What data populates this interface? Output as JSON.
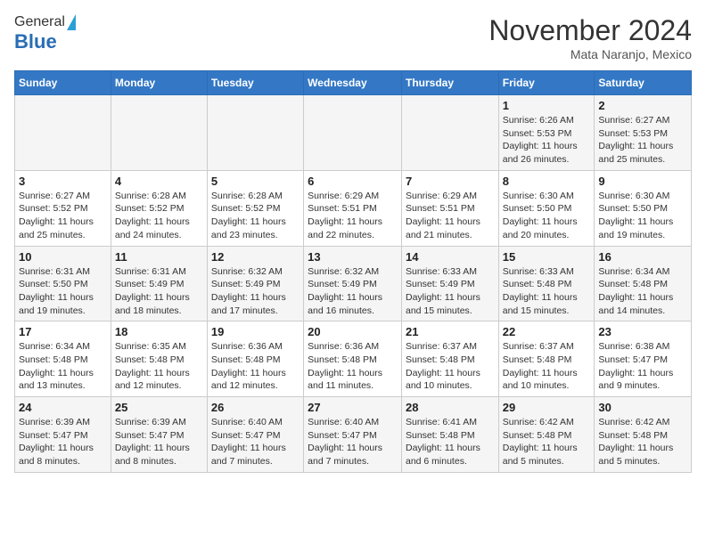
{
  "header": {
    "logo_general": "General",
    "logo_blue": "Blue",
    "month_title": "November 2024",
    "location": "Mata Naranjo, Mexico"
  },
  "columns": [
    "Sunday",
    "Monday",
    "Tuesday",
    "Wednesday",
    "Thursday",
    "Friday",
    "Saturday"
  ],
  "weeks": [
    [
      {
        "day": "",
        "info": ""
      },
      {
        "day": "",
        "info": ""
      },
      {
        "day": "",
        "info": ""
      },
      {
        "day": "",
        "info": ""
      },
      {
        "day": "",
        "info": ""
      },
      {
        "day": "1",
        "info": "Sunrise: 6:26 AM\nSunset: 5:53 PM\nDaylight: 11 hours and 26 minutes."
      },
      {
        "day": "2",
        "info": "Sunrise: 6:27 AM\nSunset: 5:53 PM\nDaylight: 11 hours and 25 minutes."
      }
    ],
    [
      {
        "day": "3",
        "info": "Sunrise: 6:27 AM\nSunset: 5:52 PM\nDaylight: 11 hours and 25 minutes."
      },
      {
        "day": "4",
        "info": "Sunrise: 6:28 AM\nSunset: 5:52 PM\nDaylight: 11 hours and 24 minutes."
      },
      {
        "day": "5",
        "info": "Sunrise: 6:28 AM\nSunset: 5:52 PM\nDaylight: 11 hours and 23 minutes."
      },
      {
        "day": "6",
        "info": "Sunrise: 6:29 AM\nSunset: 5:51 PM\nDaylight: 11 hours and 22 minutes."
      },
      {
        "day": "7",
        "info": "Sunrise: 6:29 AM\nSunset: 5:51 PM\nDaylight: 11 hours and 21 minutes."
      },
      {
        "day": "8",
        "info": "Sunrise: 6:30 AM\nSunset: 5:50 PM\nDaylight: 11 hours and 20 minutes."
      },
      {
        "day": "9",
        "info": "Sunrise: 6:30 AM\nSunset: 5:50 PM\nDaylight: 11 hours and 19 minutes."
      }
    ],
    [
      {
        "day": "10",
        "info": "Sunrise: 6:31 AM\nSunset: 5:50 PM\nDaylight: 11 hours and 19 minutes."
      },
      {
        "day": "11",
        "info": "Sunrise: 6:31 AM\nSunset: 5:49 PM\nDaylight: 11 hours and 18 minutes."
      },
      {
        "day": "12",
        "info": "Sunrise: 6:32 AM\nSunset: 5:49 PM\nDaylight: 11 hours and 17 minutes."
      },
      {
        "day": "13",
        "info": "Sunrise: 6:32 AM\nSunset: 5:49 PM\nDaylight: 11 hours and 16 minutes."
      },
      {
        "day": "14",
        "info": "Sunrise: 6:33 AM\nSunset: 5:49 PM\nDaylight: 11 hours and 15 minutes."
      },
      {
        "day": "15",
        "info": "Sunrise: 6:33 AM\nSunset: 5:48 PM\nDaylight: 11 hours and 15 minutes."
      },
      {
        "day": "16",
        "info": "Sunrise: 6:34 AM\nSunset: 5:48 PM\nDaylight: 11 hours and 14 minutes."
      }
    ],
    [
      {
        "day": "17",
        "info": "Sunrise: 6:34 AM\nSunset: 5:48 PM\nDaylight: 11 hours and 13 minutes."
      },
      {
        "day": "18",
        "info": "Sunrise: 6:35 AM\nSunset: 5:48 PM\nDaylight: 11 hours and 12 minutes."
      },
      {
        "day": "19",
        "info": "Sunrise: 6:36 AM\nSunset: 5:48 PM\nDaylight: 11 hours and 12 minutes."
      },
      {
        "day": "20",
        "info": "Sunrise: 6:36 AM\nSunset: 5:48 PM\nDaylight: 11 hours and 11 minutes."
      },
      {
        "day": "21",
        "info": "Sunrise: 6:37 AM\nSunset: 5:48 PM\nDaylight: 11 hours and 10 minutes."
      },
      {
        "day": "22",
        "info": "Sunrise: 6:37 AM\nSunset: 5:48 PM\nDaylight: 11 hours and 10 minutes."
      },
      {
        "day": "23",
        "info": "Sunrise: 6:38 AM\nSunset: 5:47 PM\nDaylight: 11 hours and 9 minutes."
      }
    ],
    [
      {
        "day": "24",
        "info": "Sunrise: 6:39 AM\nSunset: 5:47 PM\nDaylight: 11 hours and 8 minutes."
      },
      {
        "day": "25",
        "info": "Sunrise: 6:39 AM\nSunset: 5:47 PM\nDaylight: 11 hours and 8 minutes."
      },
      {
        "day": "26",
        "info": "Sunrise: 6:40 AM\nSunset: 5:47 PM\nDaylight: 11 hours and 7 minutes."
      },
      {
        "day": "27",
        "info": "Sunrise: 6:40 AM\nSunset: 5:47 PM\nDaylight: 11 hours and 7 minutes."
      },
      {
        "day": "28",
        "info": "Sunrise: 6:41 AM\nSunset: 5:48 PM\nDaylight: 11 hours and 6 minutes."
      },
      {
        "day": "29",
        "info": "Sunrise: 6:42 AM\nSunset: 5:48 PM\nDaylight: 11 hours and 5 minutes."
      },
      {
        "day": "30",
        "info": "Sunrise: 6:42 AM\nSunset: 5:48 PM\nDaylight: 11 hours and 5 minutes."
      }
    ]
  ]
}
